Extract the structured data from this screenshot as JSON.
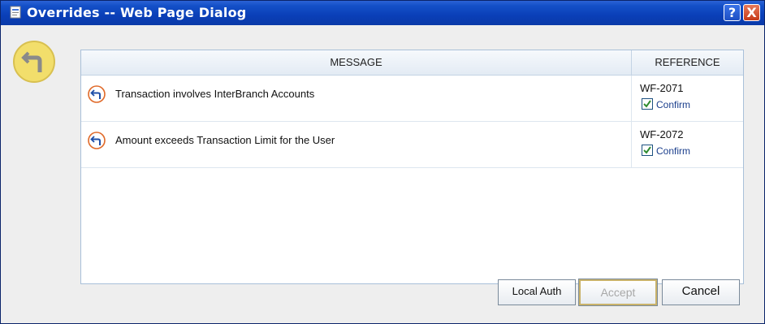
{
  "window": {
    "title": "Overrides -- Web Page Dialog",
    "help_label": "?",
    "close_label": "X"
  },
  "grid": {
    "columns": [
      "MESSAGE",
      "REFERENCE"
    ],
    "rows": [
      {
        "message": "Transaction involves InterBranch Accounts",
        "reference": "WF-2071",
        "confirm_label": "Confirm",
        "confirmed": true
      },
      {
        "message": "Amount exceeds Transaction Limit for the User",
        "reference": "WF-2072",
        "confirm_label": "Confirm",
        "confirmed": true
      }
    ]
  },
  "buttons": {
    "local_auth": "Local Auth",
    "accept": "Accept",
    "cancel": "Cancel"
  },
  "icons": {
    "title": "page-dialog-icon",
    "side": "override-sign-icon",
    "row": "override-arrow-icon"
  },
  "colors": {
    "titlebar": "#0a3fb8",
    "check": "#2e8b2e",
    "link": "#1a3e8c",
    "side_icon": "#f2de6b"
  }
}
